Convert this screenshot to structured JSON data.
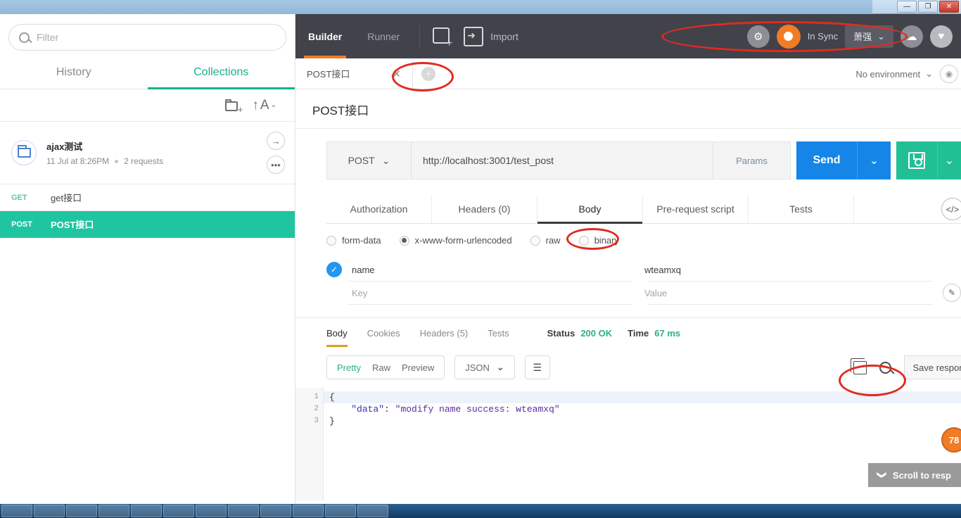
{
  "window": {
    "minimize_label": "—",
    "restore_label": "❐",
    "close_label": "✕"
  },
  "sidebar": {
    "filter": {
      "value": "",
      "placeholder": "Filter",
      "icon": "search-icon"
    },
    "tabs": [
      {
        "label": "History",
        "active": false
      },
      {
        "label": "Collections",
        "active": true
      }
    ],
    "toolbar": {
      "new_folder_icon": "folder-add-icon",
      "sort_label": "A",
      "sort_arrow": "↑",
      "sort_caret": "⌄"
    },
    "collection": {
      "name": "ajax测试",
      "timestamp": "11 Jul at 8:26PM",
      "requests_count": "2 requests",
      "open_label": "→",
      "more_label": "•••"
    },
    "requests": [
      {
        "method": "GET",
        "name": "get接口",
        "selected": false
      },
      {
        "method": "POST",
        "name": "POST接口",
        "selected": true
      }
    ],
    "collapse_label": "‹"
  },
  "topbar": {
    "tabs": [
      {
        "label": "Builder",
        "active": true
      },
      {
        "label": "Runner",
        "active": false
      }
    ],
    "new_tab_icon": "new-window-icon",
    "import_icon": "import-icon",
    "import_label": "Import",
    "settings_icon": "⚙",
    "sync_label": "In Sync",
    "user_name": "萧强",
    "user_caret": "⌄",
    "notification_icon": "☁",
    "favorites_icon": "♥",
    "accent_color": "#f07c26"
  },
  "tabstrip": {
    "open_tab": {
      "label": "POST接口",
      "close_label": "✕"
    },
    "new_tab_label": "+",
    "environment": {
      "label": "No environment",
      "caret": "⌄"
    },
    "env_eye_icon": "eye-icon"
  },
  "request": {
    "title": "POST接口",
    "method": "POST",
    "method_caret": "⌄",
    "url": "http://localhost:3001/test_post",
    "params_label": "Params",
    "send_label": "Send",
    "send_caret": "⌄",
    "save_icon": "save-floppy-icon",
    "save_caret": "⌄",
    "tabs": [
      {
        "label": "Authorization",
        "active": false
      },
      {
        "label": "Headers (0)",
        "active": false
      },
      {
        "label": "Body",
        "active": true
      },
      {
        "label": "Pre-request script",
        "active": false
      },
      {
        "label": "Tests",
        "active": false
      }
    ],
    "code_icon": "</>",
    "reset_icon": "↺",
    "body_types": [
      {
        "label": "form-data",
        "selected": false
      },
      {
        "label": "x-www-form-urlencoded",
        "selected": true
      },
      {
        "label": "raw",
        "selected": false
      },
      {
        "label": "binary",
        "selected": false
      }
    ],
    "params": {
      "rows": [
        {
          "enabled": true,
          "key": "name",
          "value": "wteamxq"
        }
      ],
      "key_placeholder": "Key",
      "value_placeholder": "Value",
      "check_glyph": "✓",
      "edit_icon": "pencil-icon"
    }
  },
  "response": {
    "tabs": [
      {
        "label": "Body",
        "active": true
      },
      {
        "label": "Cookies",
        "active": false
      },
      {
        "label": "Headers (5)",
        "active": false
      },
      {
        "label": "Tests",
        "active": false
      }
    ],
    "status_label": "Status",
    "status_value": "200 OK",
    "time_label": "Time",
    "time_value": "67 ms",
    "view_modes": [
      {
        "label": "Pretty",
        "active": true
      },
      {
        "label": "Raw",
        "active": false
      },
      {
        "label": "Preview",
        "active": false
      }
    ],
    "format": "JSON",
    "format_caret": "⌄",
    "wrap_icon": "wrap-lines-icon",
    "copy_icon": "copy-icon",
    "search_icon": "search-icon",
    "save_response_label": "Save respons",
    "line_numbers": [
      "1",
      "2",
      "3"
    ],
    "body_lines": [
      {
        "text": "{"
      },
      {
        "key": "\"data\"",
        "sep": ": ",
        "value": "\"modify name success: wteamxq\""
      },
      {
        "text": "}"
      }
    ],
    "scroll_to_response_label": "Scroll to resp",
    "scroll_chevron": "❯",
    "count_badge": "78"
  }
}
